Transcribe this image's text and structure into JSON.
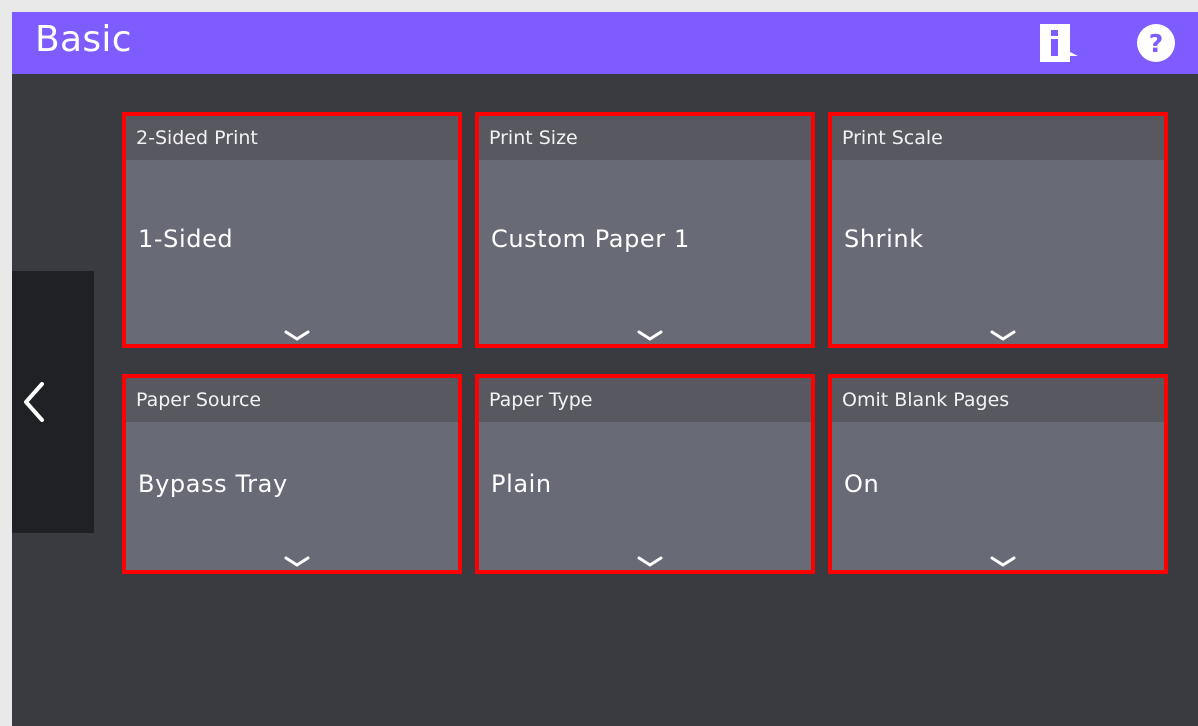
{
  "header": {
    "title": "Basic",
    "accent_color": "#7e5cff",
    "icons": [
      "info-icon",
      "help-icon"
    ]
  },
  "nav": {
    "back_icon": "chevron-left-icon"
  },
  "settings": [
    {
      "label": "2-Sided Print",
      "value": "1-Sided"
    },
    {
      "label": "Print Size",
      "value": "Custom Paper 1"
    },
    {
      "label": "Print Scale",
      "value": "Shrink"
    },
    {
      "label": "Paper Source",
      "value": "Bypass Tray"
    },
    {
      "label": "Paper Type",
      "value": "Plain"
    },
    {
      "label": "Omit Blank Pages",
      "value": "On"
    }
  ],
  "highlight_color": "#ff0000"
}
